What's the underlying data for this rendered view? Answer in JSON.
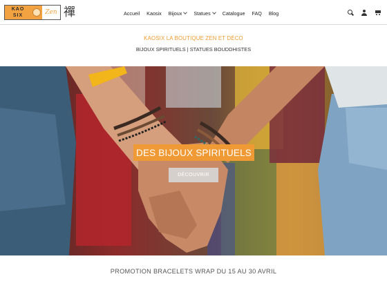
{
  "logo": {
    "line1": "KAO",
    "line2": "SIX",
    "zen": "Zen",
    "kanji": "禪"
  },
  "nav": {
    "items": [
      {
        "label": "Accueil"
      },
      {
        "label": "Kaosix"
      },
      {
        "label": "Bijoux",
        "dropdown": true
      },
      {
        "label": "Statues",
        "dropdown": true
      },
      {
        "label": "Catalogue"
      },
      {
        "label": "FAQ"
      },
      {
        "label": "Blog"
      }
    ]
  },
  "header_icons": [
    "search-icon",
    "user-icon",
    "cart-icon"
  ],
  "tagline": {
    "title": "KAOSIX LA BOUTIQUE ZEN ET DÉCO",
    "subtitle": "BIJOUX SPIRITUELS | STATUES BOUDDHISTES"
  },
  "hero": {
    "title": "DES BIJOUX SPIRITUELS",
    "button": "DÉCOUVRIR"
  },
  "promo": {
    "text": "PROMOTION BRACELETS WRAP DU 15 AU 30 AVRIL"
  },
  "colors": {
    "accent": "#f09a36",
    "text": "#333333"
  }
}
